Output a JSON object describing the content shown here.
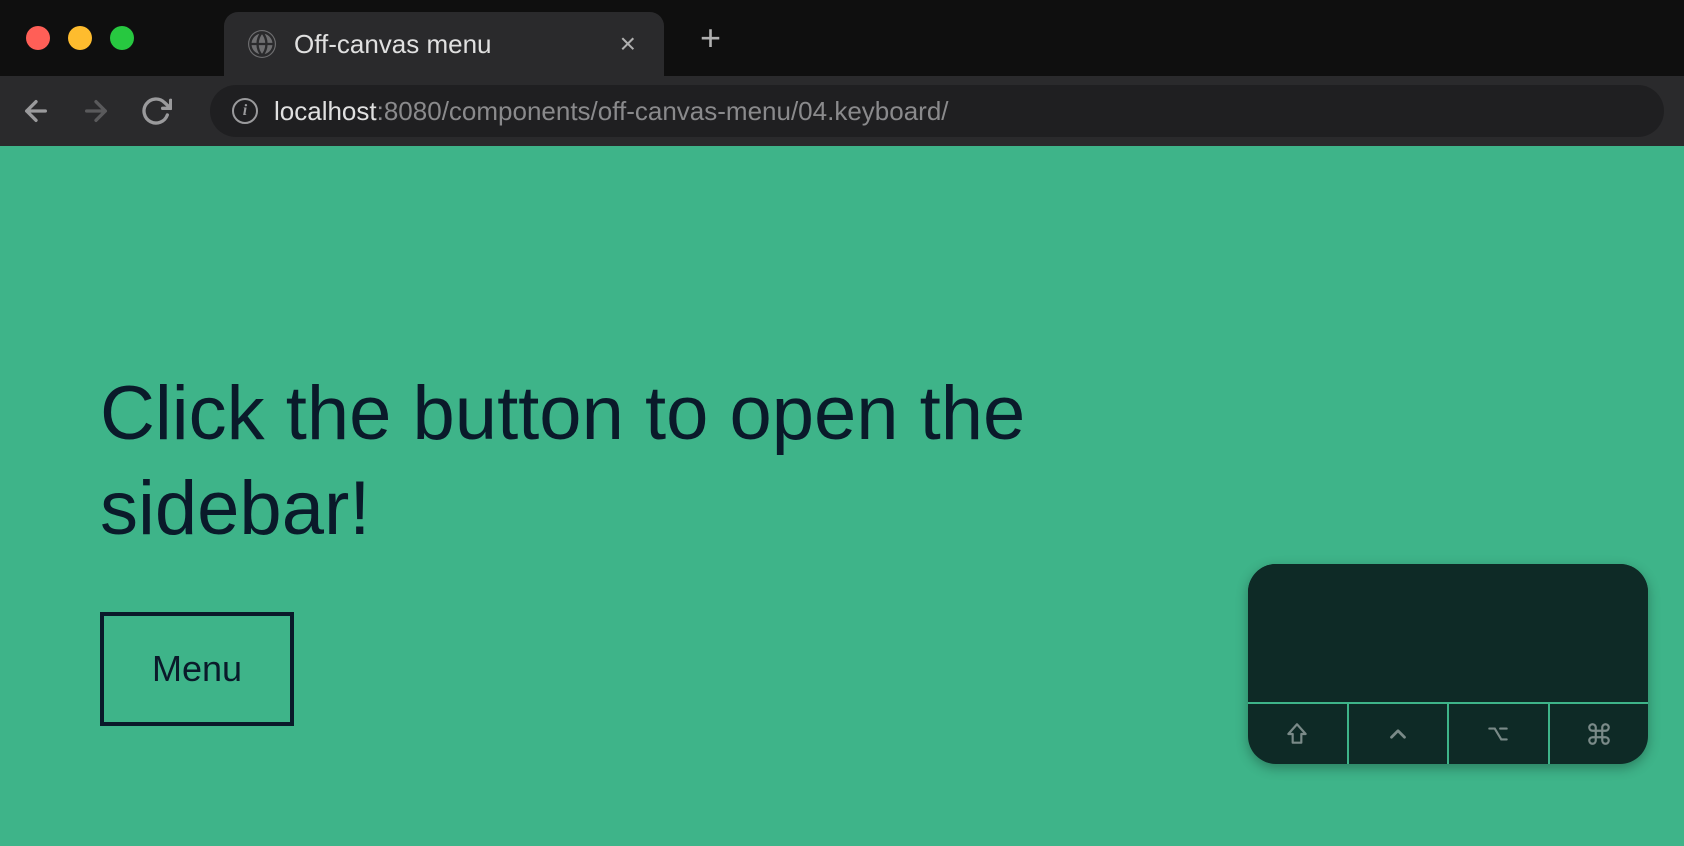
{
  "browser": {
    "tab": {
      "title": "Off-canvas menu"
    },
    "url": {
      "host": "localhost",
      "path": ":8080/components/off-canvas-menu/04.keyboard/"
    }
  },
  "page": {
    "heading": "Click the button to open the sidebar!",
    "menu_button_label": "Menu"
  },
  "modifier_keys": {
    "shift": "shift",
    "control": "control",
    "option": "option",
    "command": "command"
  }
}
